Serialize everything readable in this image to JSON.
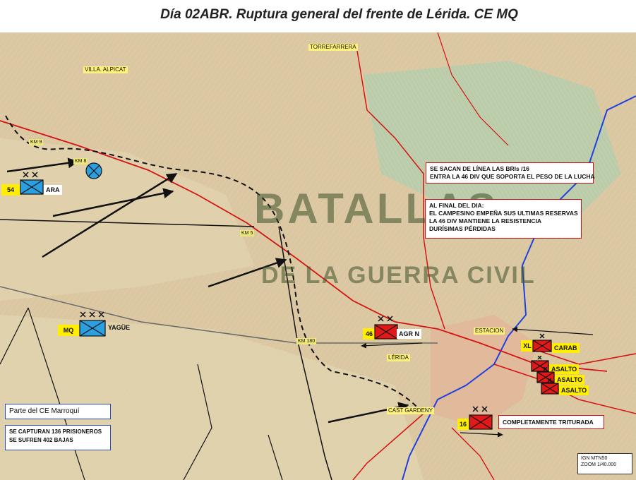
{
  "title": "Día 02ABR. Ruptura general del frente de Lérida. CE MQ",
  "colors": {
    "front_line": "#d41414",
    "river": "#2040e0",
    "unit_republican": "#e31818",
    "unit_nationalist": "#2aa0e0",
    "label_yellow": "#ffee00"
  },
  "places": {
    "torrefarrera": "TORREFARRERA",
    "villa_alpicat": "VILLA. ALPICAT",
    "estacion": "ESTACION",
    "lerida": "LÉRIDA",
    "cast_gardeny": "CAST GARDENY",
    "km9": "KM 9",
    "km8": "KM 8",
    "km5": "KM 5",
    "km180": "KM 180"
  },
  "callouts": {
    "bris": [
      "SE SACAN  DE LÍNEA LAS BRIs /16",
      "ENTRA LA 46 DIV QUE SOPORTA EL PESO DE LA LUCHA"
    ],
    "final_dia": [
      "AL FINAL DEL DIA:",
      "EL CAMPESINO EMPEÑA SUS ULTIMAS RESERVAS",
      "LA 46 DIV MANTIENE LA RESISTENCIA",
      "DURÍSIMAS PÉRDIDAS"
    ],
    "triturada": "COMPLETAMENTE TRITURADA"
  },
  "info_boxes": {
    "parte": "Parte del CE Marroquí",
    "prisioneros": [
      "SE CAPTURAN 136 PRISIONEROS",
      "SE SUFREN 402 BAJAS"
    ],
    "ign": [
      "IGN MTN50",
      "ZOOM 1/40.000"
    ]
  },
  "units": {
    "ara": {
      "number": "54",
      "name": "ARA",
      "icon": "infantry-division-icon"
    },
    "mq": {
      "number": "MQ",
      "name": "YAGÜE",
      "icon": "infantry-army-corps-icon"
    },
    "agr_n": {
      "number": "46",
      "name": "AGR N",
      "icon": "infantry-division-icon"
    },
    "carab": {
      "number": "XL",
      "name": "CARAB",
      "icon": "infantry-brigade-icon"
    },
    "asalto": [
      "ASALTO",
      "ASALTO",
      "ASALTO"
    ],
    "div16": {
      "number": "16",
      "icon": "infantry-division-icon"
    }
  },
  "watermark": {
    "line1": "BATALLAS",
    "line2": "DE LA GUERRA CIVIL"
  }
}
